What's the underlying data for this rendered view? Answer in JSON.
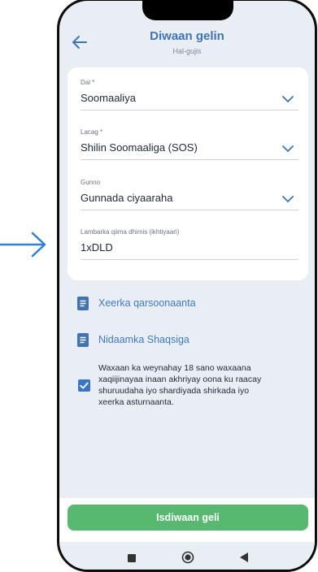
{
  "header": {
    "title": "Diwaan gelin",
    "subtitle": "Hal-gujis"
  },
  "form": {
    "country": {
      "label": "Dal *",
      "value": "Soomaaliya"
    },
    "currency": {
      "label": "Lacag *",
      "value": "Shilin Soomaaliga (SOS)"
    },
    "bonus": {
      "label": "Gunno",
      "value": "Gunnada ciyaaraha"
    },
    "promo": {
      "label": "Lambarka qiima dhimis (ikhtiyaari)",
      "value": "1xDLD"
    }
  },
  "links": {
    "terms": "Xeerka qarsoonaanta",
    "privacy": "Nidaamka Shaqsiga"
  },
  "consent": {
    "checked": true,
    "text": "Waxaan ka weynahay 18 sano waxaana xaqiijinayaa inaan akhriyay oona ku raacay shuruudaha iyo shardiyada shirkada iyo xeerka asturnaanta."
  },
  "submit_label": "Isdiwaan geli",
  "colors": {
    "accent": "#3f74b4",
    "button": "#56b96f",
    "background": "#e9eef5",
    "arrow": "#2f7fd6"
  }
}
